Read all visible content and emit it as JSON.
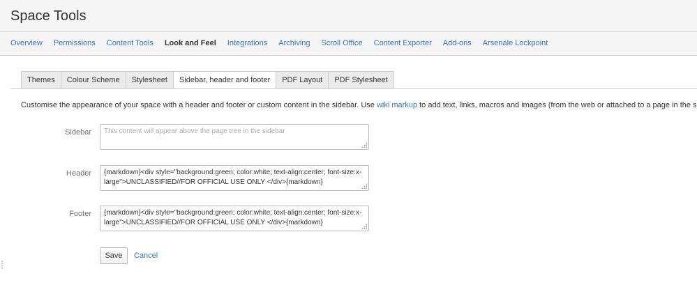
{
  "page": {
    "title": "Space Tools"
  },
  "nav": {
    "tabs": [
      {
        "label": "Overview"
      },
      {
        "label": "Permissions"
      },
      {
        "label": "Content Tools"
      },
      {
        "label": "Look and Feel"
      },
      {
        "label": "Integrations"
      },
      {
        "label": "Archiving"
      },
      {
        "label": "Scroll Office"
      },
      {
        "label": "Content Exporter"
      },
      {
        "label": "Add-ons"
      },
      {
        "label": "Arsenale Lockpoint"
      }
    ],
    "active_tab": "Look and Feel"
  },
  "subtabs": {
    "items": [
      {
        "label": "Themes"
      },
      {
        "label": "Colour Scheme"
      },
      {
        "label": "Stylesheet"
      },
      {
        "label": "Sidebar, header and footer"
      },
      {
        "label": "PDF Layout"
      },
      {
        "label": "PDF Stylesheet"
      }
    ],
    "active": "Sidebar, header and footer"
  },
  "description": {
    "before": "Customise the appearance of your space with a header and footer or custom content in the sidebar. Use ",
    "link": "wiki markup",
    "after": " to add text, links, macros and images (from the web or attached to a page in the space)"
  },
  "form": {
    "sidebar": {
      "label": "Sidebar",
      "value": "",
      "placeholder": "This content will appear above the page tree in the sidebar"
    },
    "header": {
      "label": "Header",
      "value": "{markdown}<div style=\"background:green; color:white; text-align:center; font-size:x-large\">UNCLASSIFIED//FOR OFFICIAL USE ONLY </div>{markdown}"
    },
    "footer": {
      "label": "Footer",
      "value": "{markdown}<div style=\"background:green; color:white; text-align:center; font-size:x-large\">UNCLASSIFIED//FOR OFFICIAL USE ONLY </div>{markdown}"
    },
    "save_label": "Save",
    "cancel_label": "Cancel"
  },
  "colors": {
    "link": "#3b73af",
    "header_background": "#f5f5f5"
  }
}
